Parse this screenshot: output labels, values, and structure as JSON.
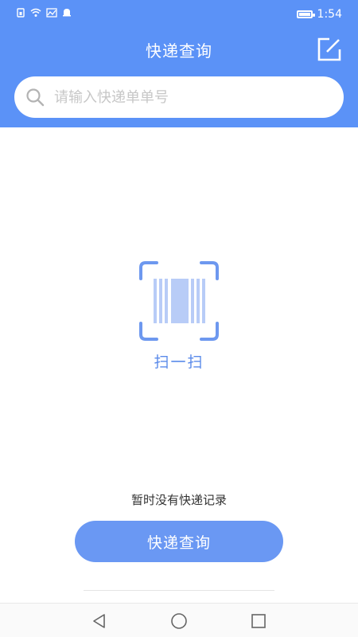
{
  "status_bar": {
    "time": "1:54",
    "icons": [
      "sim-icon",
      "wifi-icon",
      "signal-chart-icon",
      "notification-bell-icon",
      "battery-icon"
    ]
  },
  "header": {
    "title": "快递查询",
    "edit_icon": "edit-icon"
  },
  "search": {
    "placeholder": "请输入快递单单号",
    "icon": "search-icon"
  },
  "scan": {
    "label": "扫一扫",
    "icon": "barcode-scan-icon"
  },
  "empty_state": {
    "text": "暂时没有快递记录"
  },
  "query_button": {
    "label": "快递查询"
  },
  "nav_bar": {
    "icons": [
      "back-icon",
      "home-icon",
      "recents-icon"
    ]
  },
  "colors": {
    "header_bg": "#5b92f7",
    "button_bg": "#6a98f3",
    "scan_blue": "#5b8bea"
  }
}
